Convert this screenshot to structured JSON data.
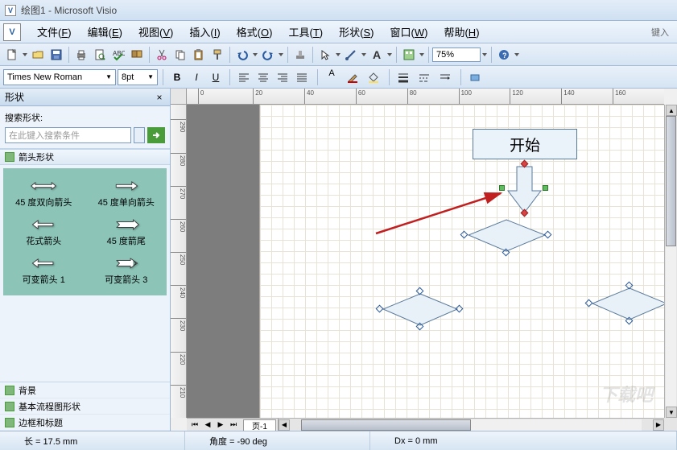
{
  "title": "绘图1 - Microsoft Visio",
  "menu": {
    "file": "文件(",
    "file_u": "F",
    "file_end": ")",
    "edit": "编辑(",
    "edit_u": "E",
    "edit_end": ")",
    "view": "视图(",
    "view_u": "V",
    "view_end": ")",
    "insert": "插入(",
    "insert_u": "I",
    "insert_end": ")",
    "format": "格式(",
    "format_u": "O",
    "format_end": ")",
    "tools": "工具(",
    "tools_u": "T",
    "tools_end": ")",
    "shape": "形状(",
    "shape_u": "S",
    "shape_end": ")",
    "window": "窗口(",
    "window_u": "W",
    "window_end": ")",
    "help": "帮助(",
    "help_u": "H",
    "help_end": ")",
    "keyin": "键入"
  },
  "toolbar": {
    "zoom": "75%"
  },
  "format": {
    "font": "Times New Roman",
    "size": "8pt",
    "bold": "B",
    "italic": "I",
    "underline": "U",
    "font_a": "A"
  },
  "shapes_pane": {
    "title": "形状",
    "search_label": "搜索形状:",
    "search_placeholder": "在此键入搜索条件",
    "stencil_arrows": "箭头形状",
    "shapes": {
      "s1": "45 度双向箭头",
      "s2": "45 度单向箭头",
      "s3": "花式箭头",
      "s4": "45 度箭尾",
      "s5": "可变箭头 1",
      "s6": "可变箭头 3"
    },
    "stencil_bg": "背景",
    "stencil_flow": "基本流程图形状",
    "stencil_border": "边框和标题"
  },
  "canvas": {
    "start_text": "开始",
    "page_tab": "页-1"
  },
  "ruler_h": [
    "0",
    "20",
    "40",
    "60",
    "80",
    "100",
    "120",
    "140",
    "160"
  ],
  "ruler_v": [
    "290",
    "280",
    "270",
    "260",
    "250",
    "240",
    "230",
    "220",
    "210"
  ],
  "status": {
    "length": "长 = 17.5 mm",
    "angle": "角度 = -90 deg",
    "dx": "Dx = 0 mm"
  },
  "watermark": "下载吧"
}
